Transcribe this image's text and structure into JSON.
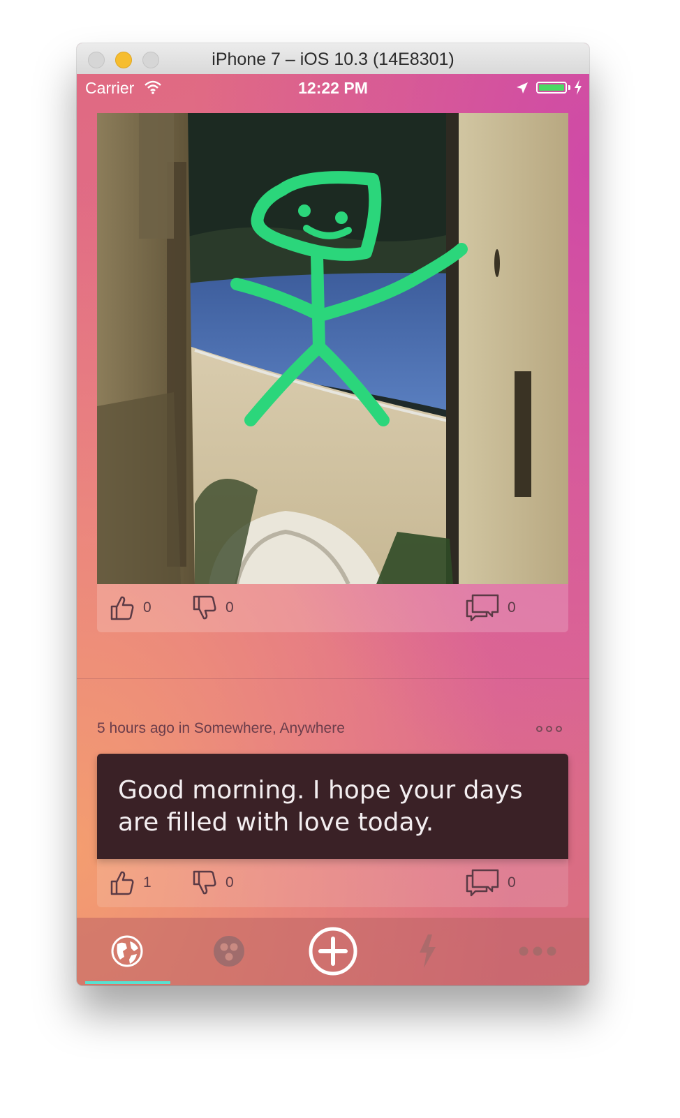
{
  "window": {
    "title": "iPhone 7 – iOS 10.3 (14E8301)"
  },
  "status_bar": {
    "carrier": "Carrier",
    "time": "12:22 PM",
    "battery_charging": true
  },
  "feed": {
    "posts": [
      {
        "type": "photo",
        "image": "beach alley photo with green stick-figure drawing",
        "likes": "0",
        "dislikes": "0",
        "comments": "0"
      },
      {
        "type": "text",
        "meta": "5 hours ago in Somewhere, Anywhere",
        "text": "Good morning. I hope your days are filled with love today.",
        "likes": "1",
        "dislikes": "0",
        "comments": "0"
      }
    ]
  },
  "tab_bar": {
    "tabs": [
      {
        "icon": "globe-icon",
        "selected": true
      },
      {
        "icon": "group-icon",
        "selected": false
      },
      {
        "icon": "add-circle-icon",
        "selected": false
      },
      {
        "icon": "lightning-icon",
        "selected": false
      },
      {
        "icon": "more-icon",
        "selected": false
      }
    ],
    "indicator_color": "#59e0d0"
  },
  "colors": {
    "drawing_stroke": "#2bd67b",
    "text_card_bg": "#3a2126"
  }
}
